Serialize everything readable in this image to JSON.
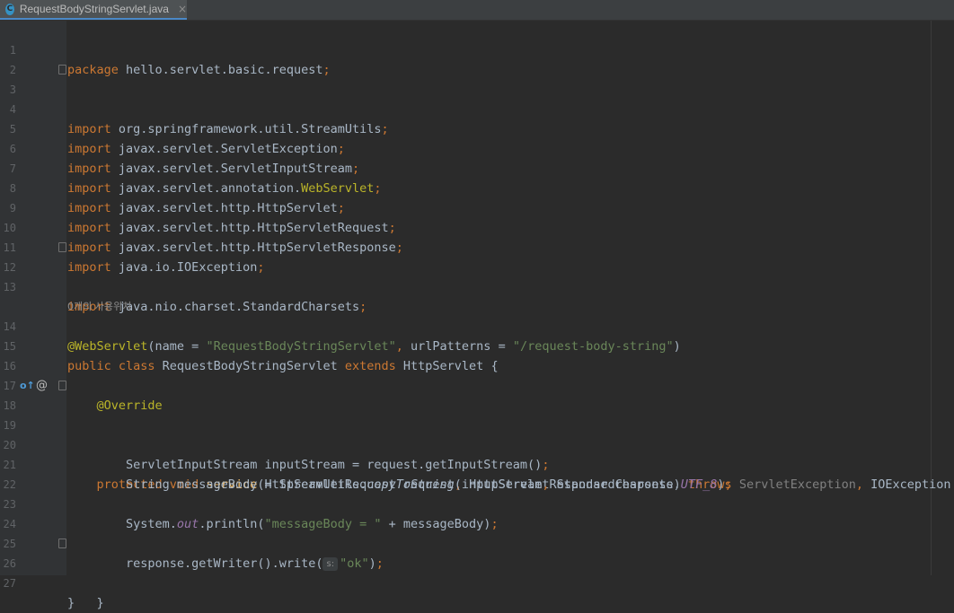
{
  "tab": {
    "title": "RequestBodyStringServlet.java",
    "close": "×",
    "icon": "C"
  },
  "gutter": {
    "override_icon": "o↑",
    "annotation_icon": "@"
  },
  "usages_hint": "0개의 사용위치",
  "param_hint": "s:",
  "lines": [
    {
      "n": "1",
      "code": [
        "package",
        " hello.servlet.basic.request",
        ";"
      ]
    },
    {
      "n": "2"
    },
    {
      "n": "3",
      "code": [
        "import",
        " org.springframework.util.StreamUtils",
        ";"
      ]
    },
    {
      "n": "4"
    },
    {
      "n": "5",
      "code": [
        "import",
        " javax.servlet.ServletException",
        ";"
      ]
    },
    {
      "n": "6",
      "code": [
        "import",
        " javax.servlet.ServletInputStream",
        ";"
      ]
    },
    {
      "n": "7",
      "code": [
        "import",
        " javax.servlet.annotation.",
        "WebServlet",
        ";"
      ]
    },
    {
      "n": "8",
      "code": [
        "import",
        " javax.servlet.http.HttpServlet",
        ";"
      ]
    },
    {
      "n": "9",
      "code": [
        "import",
        " javax.servlet.http.HttpServletRequest",
        ";"
      ]
    },
    {
      "n": "10",
      "code": [
        "import",
        " javax.servlet.http.HttpServletResponse",
        ";"
      ]
    },
    {
      "n": "11",
      "code": [
        "import",
        " java.io.IOException",
        ";"
      ]
    },
    {
      "n": "12",
      "code": [
        "import",
        " java.nio.charset.StandardCharsets",
        ";"
      ]
    },
    {
      "n": "13"
    },
    {
      "n": "14",
      "code": [
        "@WebServlet",
        "(name = ",
        "\"RequestBodyStringServlet\"",
        ", ",
        "urlPatterns = ",
        "\"/request-body-string\"",
        ")"
      ]
    },
    {
      "n": "15",
      "code": [
        "public class",
        " RequestBodyStringServlet ",
        "extends",
        " HttpServlet {"
      ]
    },
    {
      "n": "16"
    },
    {
      "n": "17",
      "code": [
        "    ",
        "@Override"
      ]
    },
    {
      "n": "18",
      "code": [
        "    ",
        "protected void",
        " ",
        "service",
        "(HttpServletRequest request",
        ", ",
        "HttpServletResponse response) ",
        "throws",
        " ",
        "ServletException",
        ", ",
        "IOException {"
      ]
    },
    {
      "n": "19"
    },
    {
      "n": "20",
      "code": [
        "        ServletInputStream inputStream = request.getInputStream()",
        ";"
      ]
    },
    {
      "n": "21",
      "code": [
        "        String messageBody = StreamUtils.",
        "copyToString",
        "(inputStream",
        ", ",
        "StandardCharsets.",
        "UTF_8",
        ")",
        ";"
      ]
    },
    {
      "n": "22"
    },
    {
      "n": "23",
      "code": [
        "        System.",
        "out",
        ".println(",
        "\"messageBody = \"",
        " + messageBody)",
        ";"
      ]
    },
    {
      "n": "24"
    },
    {
      "n": "25",
      "code": [
        "        response.getWriter().write(",
        "\"ok\"",
        ")",
        ";"
      ]
    },
    {
      "n": "26",
      "code": [
        "    }"
      ]
    },
    {
      "n": "27",
      "code": [
        "}"
      ]
    }
  ]
}
